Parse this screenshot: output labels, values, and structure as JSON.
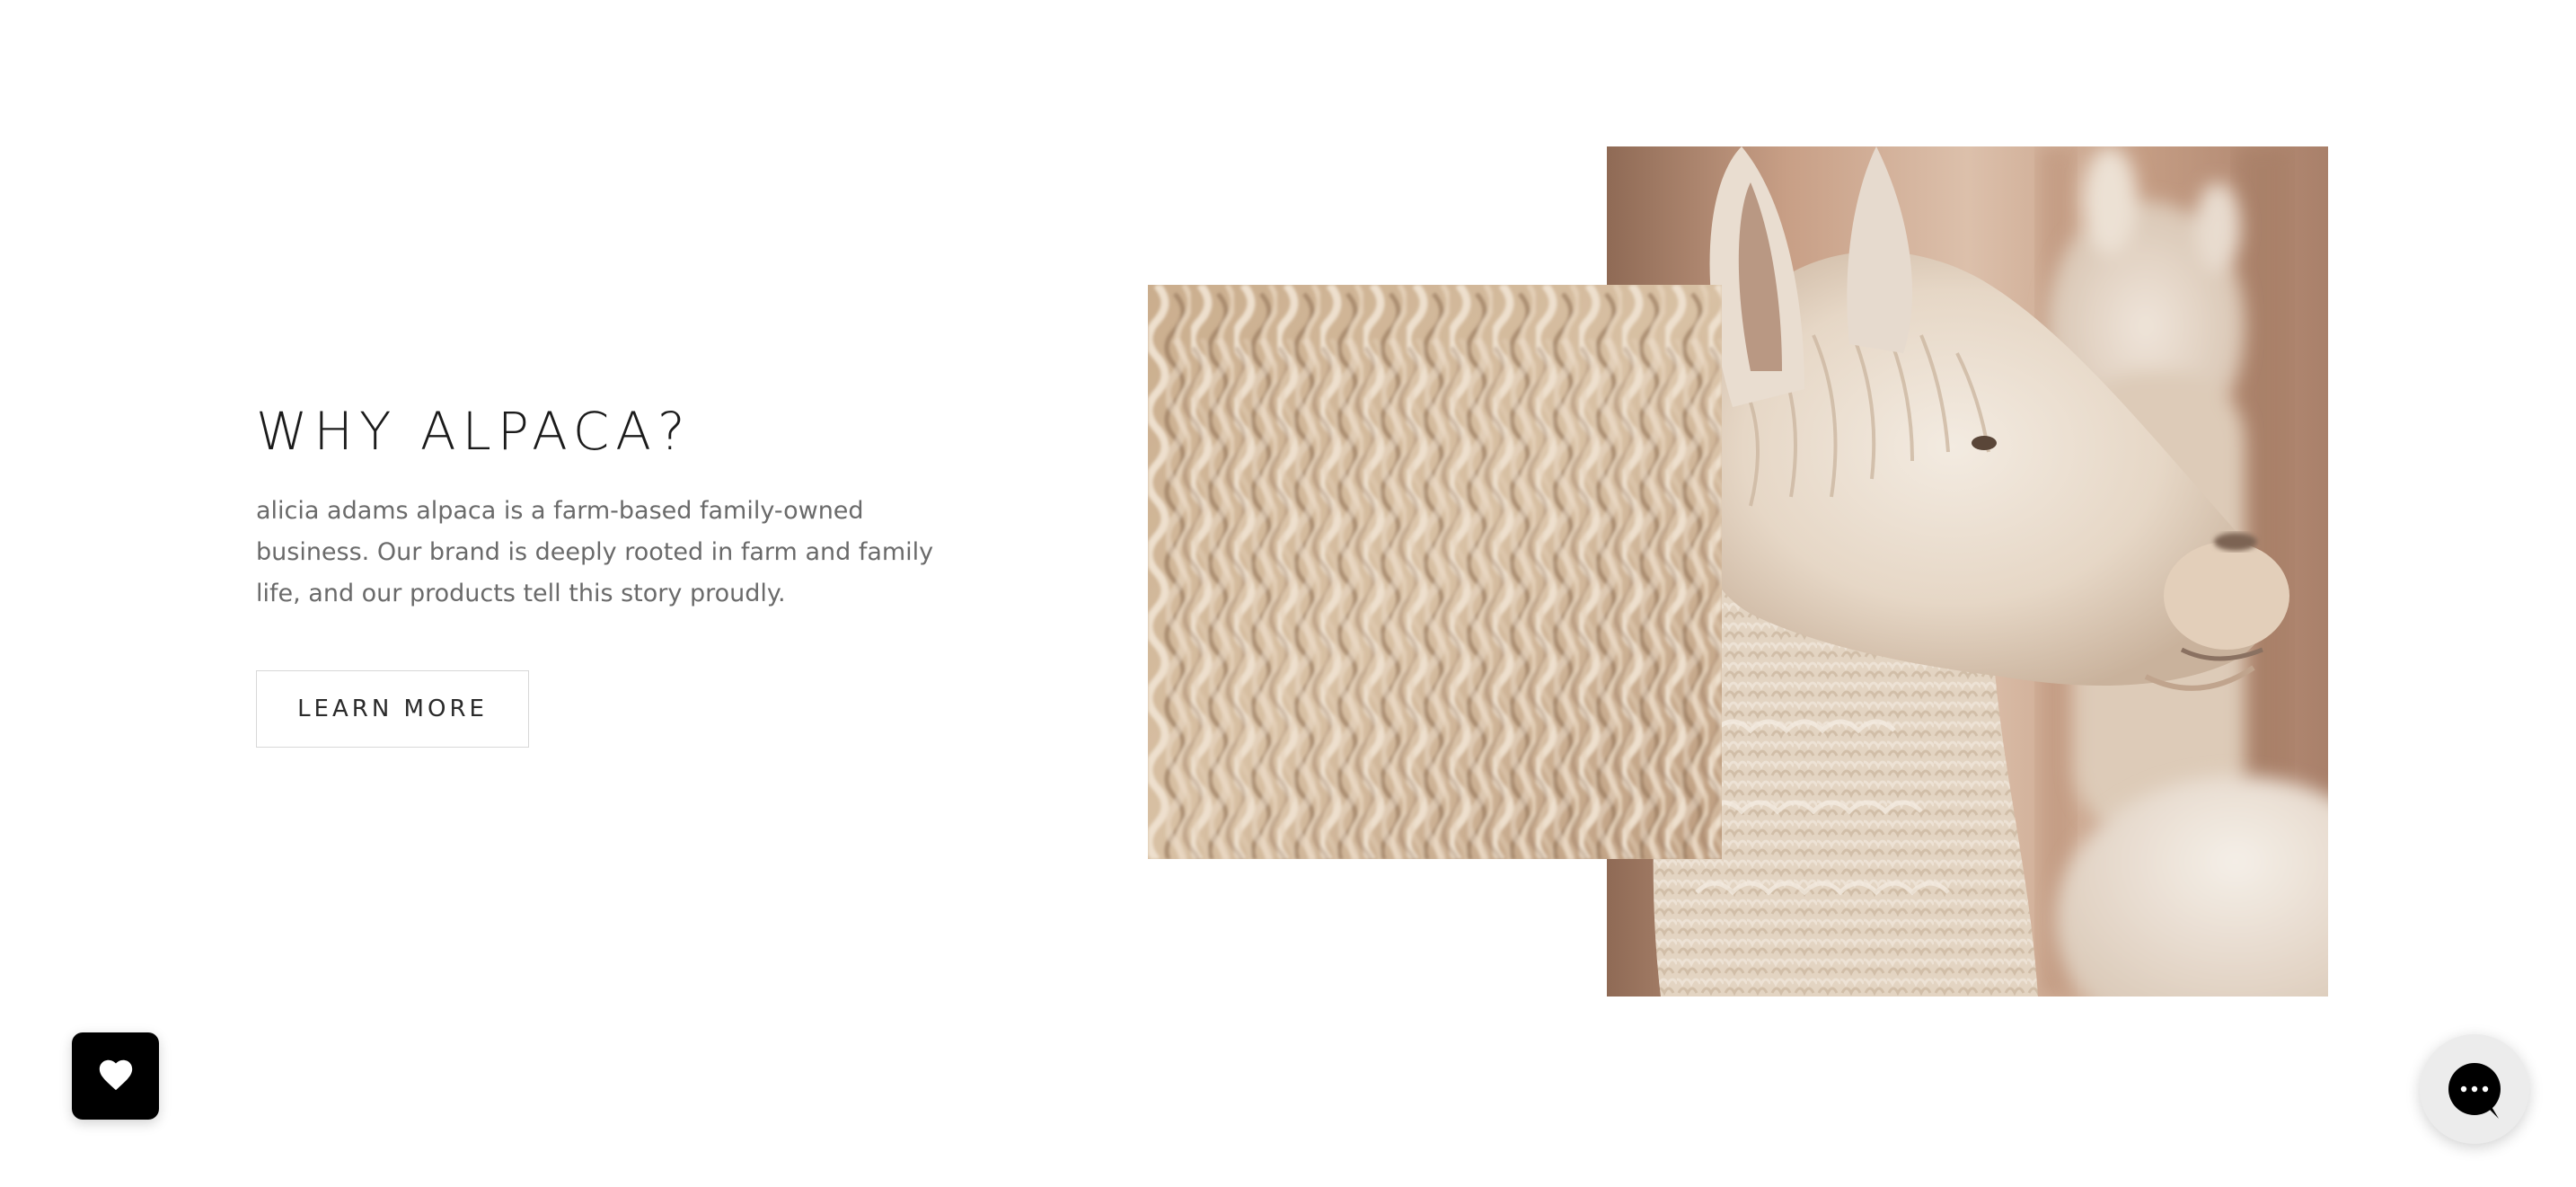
{
  "section": {
    "heading": "WHY ALPACA?",
    "body": "alicia adams alpaca is a farm-based family-owned business. Our brand is deeply rooted in farm and family life, and our products tell this story proudly.",
    "cta_label": "LEARN MORE"
  },
  "images": {
    "alpaca_photo": "alpaca-portrait-image",
    "fiber_photo": "alpaca-fiber-closeup-image"
  },
  "widgets": {
    "wishlist_icon": "heart-icon",
    "chat_icon": "chat-bubble-icon"
  },
  "colors": {
    "heading": "#1b1b1b",
    "body": "#6a6a6a",
    "button_border": "#d8d8d8",
    "widget_bg": "#000000"
  }
}
